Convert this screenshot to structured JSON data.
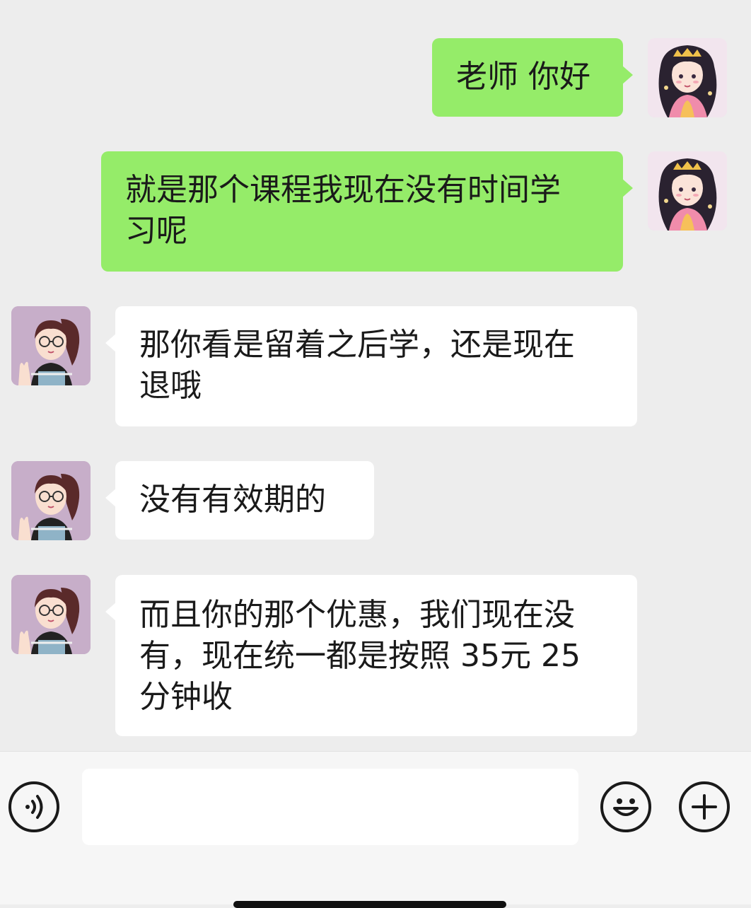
{
  "messages": [
    {
      "sender": "me",
      "lines": [
        "老师 你好"
      ]
    },
    {
      "sender": "me",
      "lines": [
        "就是那个课程我现在没有时间学",
        "习呢"
      ]
    },
    {
      "sender": "teacher",
      "lines": [
        "那你看是留着之后学，还是现在",
        "退哦"
      ]
    },
    {
      "sender": "teacher",
      "lines": [
        "没有有效期的"
      ]
    },
    {
      "sender": "teacher",
      "lines": [
        "而且你的那个优惠，我们现在没",
        "有，现在统一都是按照 35元 25",
        "分钟收"
      ]
    }
  ],
  "input": {
    "value": "",
    "placeholder": ""
  },
  "colors": {
    "chat_bg": "#ededed",
    "my_bubble": "#95ec69",
    "their_bubble": "#ffffff",
    "text": "#1a1a1a"
  },
  "icons": {
    "voice": "voice-icon",
    "emoji": "emoji-icon",
    "more": "plus-icon"
  }
}
